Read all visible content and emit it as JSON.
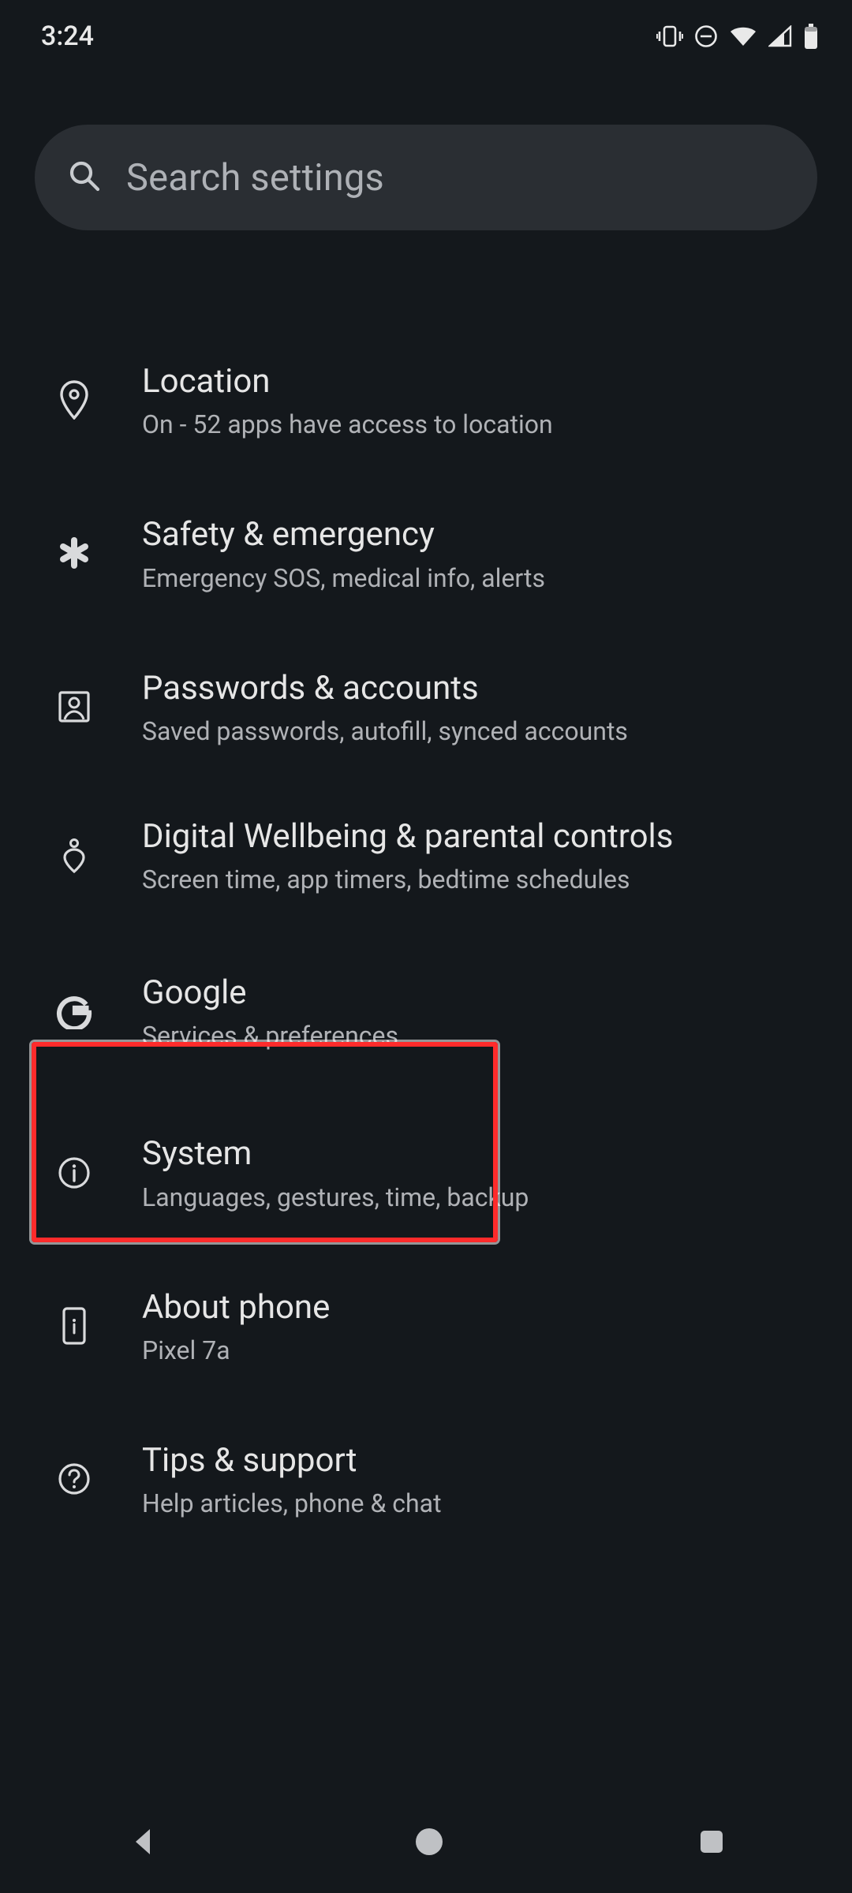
{
  "status": {
    "time": "3:24"
  },
  "search": {
    "placeholder": "Search settings"
  },
  "rows": {
    "location": {
      "title": "Location",
      "subtitle": "On - 52 apps have access to location"
    },
    "safety": {
      "title": "Safety & emergency",
      "subtitle": "Emergency SOS, medical info, alerts"
    },
    "passwords": {
      "title": "Passwords & accounts",
      "subtitle": "Saved passwords, autofill, synced accounts"
    },
    "wellbeing": {
      "title": "Digital Wellbeing & parental controls",
      "subtitle": "Screen time, app timers, bedtime schedules"
    },
    "google": {
      "title": "Google",
      "subtitle": "Services & preferences"
    },
    "system": {
      "title": "System",
      "subtitle": "Languages, gestures, time, backup"
    },
    "about": {
      "title": "About phone",
      "subtitle": "Pixel 7a"
    },
    "tips": {
      "title": "Tips & support",
      "subtitle": "Help articles, phone & chat"
    }
  }
}
